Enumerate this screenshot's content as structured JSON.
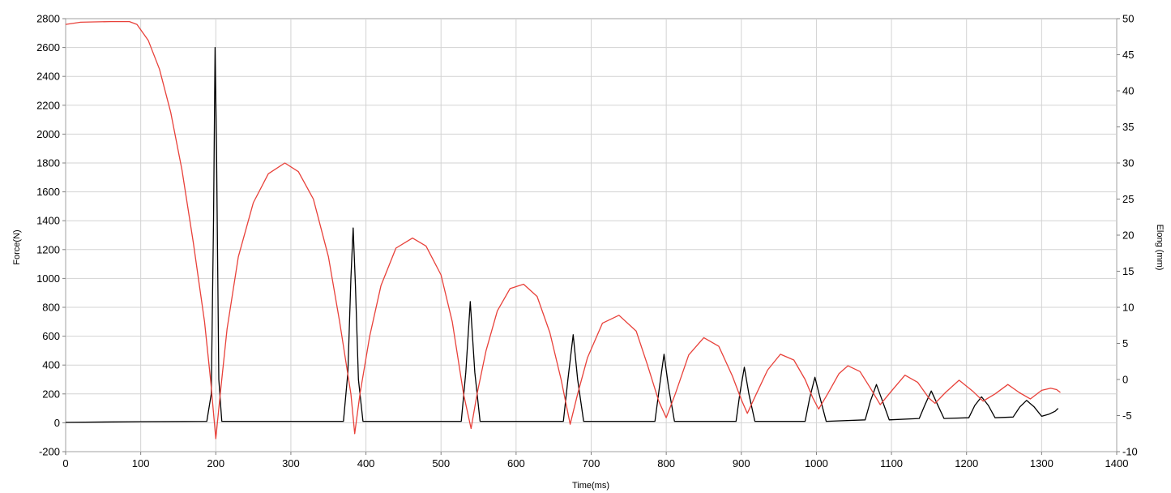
{
  "chart_data": {
    "type": "line",
    "xlabel": "Time(ms)",
    "ylabel_left": "Force(N)",
    "ylabel_right": "Elong (mm)",
    "xlim": [
      0,
      1400
    ],
    "ylim_left": [
      -200,
      2800
    ],
    "ylim_right": [
      -10,
      50
    ],
    "x_ticks": [
      0,
      100,
      200,
      300,
      400,
      500,
      600,
      700,
      800,
      900,
      1000,
      1100,
      1200,
      1300,
      1400
    ],
    "y_left_ticks": [
      -200,
      0,
      200,
      400,
      600,
      800,
      1000,
      1200,
      1400,
      1600,
      1800,
      2000,
      2200,
      2400,
      2600,
      2800
    ],
    "y_right_ticks": [
      -10,
      -5,
      0,
      5,
      10,
      15,
      20,
      25,
      30,
      35,
      40,
      45,
      50
    ],
    "grid": true,
    "series": [
      {
        "axis": "left",
        "color": "#000000",
        "points": [
          [
            0,
            3
          ],
          [
            100,
            8
          ],
          [
            188,
            10
          ],
          [
            194,
            200
          ],
          [
            197,
            1400
          ],
          [
            199,
            2600
          ],
          [
            201,
            1900
          ],
          [
            204,
            300
          ],
          [
            208,
            10
          ],
          [
            370,
            10
          ],
          [
            376,
            350
          ],
          [
            380,
            1000
          ],
          [
            383,
            1350
          ],
          [
            386,
            950
          ],
          [
            390,
            300
          ],
          [
            396,
            10
          ],
          [
            527,
            10
          ],
          [
            533,
            350
          ],
          [
            539,
            840
          ],
          [
            545,
            350
          ],
          [
            552,
            10
          ],
          [
            663,
            10
          ],
          [
            669,
            300
          ],
          [
            676,
            610
          ],
          [
            682,
            300
          ],
          [
            690,
            10
          ],
          [
            785,
            10
          ],
          [
            791,
            250
          ],
          [
            797,
            475
          ],
          [
            803,
            250
          ],
          [
            811,
            10
          ],
          [
            893,
            10
          ],
          [
            898,
            200
          ],
          [
            904,
            385
          ],
          [
            910,
            200
          ],
          [
            918,
            10
          ],
          [
            985,
            10
          ],
          [
            991,
            170
          ],
          [
            998,
            315
          ],
          [
            1005,
            170
          ],
          [
            1013,
            10
          ],
          [
            1065,
            20
          ],
          [
            1072,
            150
          ],
          [
            1080,
            265
          ],
          [
            1088,
            150
          ],
          [
            1097,
            20
          ],
          [
            1137,
            30
          ],
          [
            1145,
            130
          ],
          [
            1153,
            220
          ],
          [
            1161,
            130
          ],
          [
            1170,
            30
          ],
          [
            1203,
            35
          ],
          [
            1211,
            120
          ],
          [
            1220,
            180
          ],
          [
            1229,
            120
          ],
          [
            1238,
            35
          ],
          [
            1262,
            40
          ],
          [
            1271,
            110
          ],
          [
            1280,
            155
          ],
          [
            1290,
            110
          ],
          [
            1300,
            45
          ],
          [
            1310,
            60
          ],
          [
            1318,
            80
          ],
          [
            1322,
            100
          ]
        ]
      },
      {
        "axis": "right",
        "color": "#e8413a",
        "points": [
          [
            0,
            49.2
          ],
          [
            20,
            49.5
          ],
          [
            60,
            49.6
          ],
          [
            85,
            49.6
          ],
          [
            95,
            49.2
          ],
          [
            110,
            47
          ],
          [
            125,
            43
          ],
          [
            140,
            37
          ],
          [
            155,
            29
          ],
          [
            170,
            19
          ],
          [
            185,
            8
          ],
          [
            193,
            0
          ],
          [
            200,
            -8.2
          ],
          [
            206,
            -2
          ],
          [
            215,
            7
          ],
          [
            230,
            17
          ],
          [
            250,
            24.5
          ],
          [
            270,
            28.5
          ],
          [
            292,
            30
          ],
          [
            310,
            28.8
          ],
          [
            330,
            25
          ],
          [
            350,
            17
          ],
          [
            365,
            8
          ],
          [
            380,
            -2
          ],
          [
            385,
            -7.5
          ],
          [
            392,
            -2
          ],
          [
            405,
            6
          ],
          [
            420,
            13
          ],
          [
            440,
            18.2
          ],
          [
            462,
            19.6
          ],
          [
            480,
            18.5
          ],
          [
            500,
            14.5
          ],
          [
            515,
            8
          ],
          [
            530,
            -2
          ],
          [
            540,
            -6.8
          ],
          [
            548,
            -2
          ],
          [
            560,
            4
          ],
          [
            575,
            9.5
          ],
          [
            592,
            12.6
          ],
          [
            610,
            13.2
          ],
          [
            628,
            11.5
          ],
          [
            645,
            6.5
          ],
          [
            660,
            0
          ],
          [
            672,
            -6.2
          ],
          [
            682,
            -2
          ],
          [
            695,
            3
          ],
          [
            715,
            7.8
          ],
          [
            737,
            8.9
          ],
          [
            760,
            6.7
          ],
          [
            775,
            2
          ],
          [
            790,
            -3
          ],
          [
            800,
            -5.3
          ],
          [
            812,
            -2
          ],
          [
            830,
            3.4
          ],
          [
            850,
            5.8
          ],
          [
            870,
            4.6
          ],
          [
            888,
            0.5
          ],
          [
            900,
            -2.8
          ],
          [
            908,
            -4.7
          ],
          [
            920,
            -2
          ],
          [
            935,
            1.3
          ],
          [
            952,
            3.5
          ],
          [
            970,
            2.7
          ],
          [
            985,
            0
          ],
          [
            995,
            -2.5
          ],
          [
            1003,
            -4.1
          ],
          [
            1015,
            -2
          ],
          [
            1030,
            0.8
          ],
          [
            1042,
            1.9
          ],
          [
            1058,
            1.1
          ],
          [
            1072,
            -1.2
          ],
          [
            1085,
            -3.5
          ],
          [
            1100,
            -1.6
          ],
          [
            1118,
            0.6
          ],
          [
            1135,
            -0.4
          ],
          [
            1150,
            -2.6
          ],
          [
            1158,
            -3.3
          ],
          [
            1172,
            -1.8
          ],
          [
            1190,
            -0.1
          ],
          [
            1208,
            -1.6
          ],
          [
            1222,
            -3.0
          ],
          [
            1238,
            -2
          ],
          [
            1255,
            -0.7
          ],
          [
            1270,
            -1.8
          ],
          [
            1285,
            -2.7
          ],
          [
            1300,
            -1.5
          ],
          [
            1312,
            -1.2
          ],
          [
            1320,
            -1.4
          ],
          [
            1325,
            -1.8
          ]
        ]
      }
    ]
  }
}
